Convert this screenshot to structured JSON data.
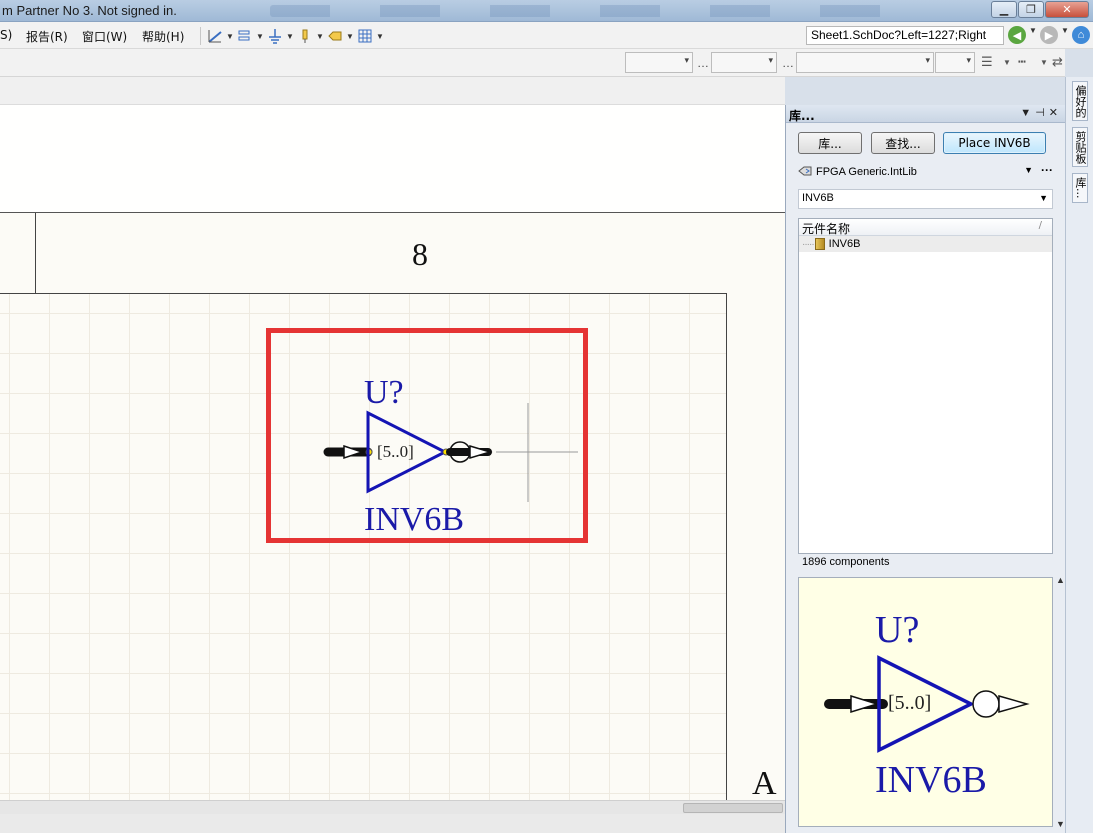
{
  "titlebar": {
    "title": "m Partner No 3. Not signed in.",
    "minimize": "▁",
    "restore": "❐",
    "close": "✕"
  },
  "menu": {
    "items": [
      {
        "label": "S)"
      },
      {
        "label": "报告(R)"
      },
      {
        "label": "窗口(W)"
      },
      {
        "label": "帮助(H)"
      }
    ],
    "sheet_path": "Sheet1.SchDoc?Left=1227;Right"
  },
  "sheet": {
    "zone_number": "8",
    "zone_letter": "A",
    "component": {
      "designator": "U?",
      "pin_label": "[5..0]",
      "comment": "INV6B"
    }
  },
  "panel": {
    "title": "库...",
    "buttons": {
      "libraries": "库...",
      "search": "查找...",
      "place": "Place INV6B"
    },
    "library": "FPGA Generic.IntLib",
    "filter": "INV6B",
    "column_header": "元件名称",
    "items": [
      {
        "name": "INV6B"
      }
    ],
    "component_count": "1896 components"
  },
  "preview": {
    "designator": "U?",
    "pin_label": "[5..0]",
    "comment": "INV6B"
  },
  "side_tabs": [
    {
      "label": "偏好的"
    },
    {
      "label": "剪贴板"
    },
    {
      "label": "库..."
    }
  ],
  "colors": {
    "highlight": "#e53434",
    "component_blue": "#1a1aa8",
    "symbol_stroke": "#0a0ab0"
  }
}
